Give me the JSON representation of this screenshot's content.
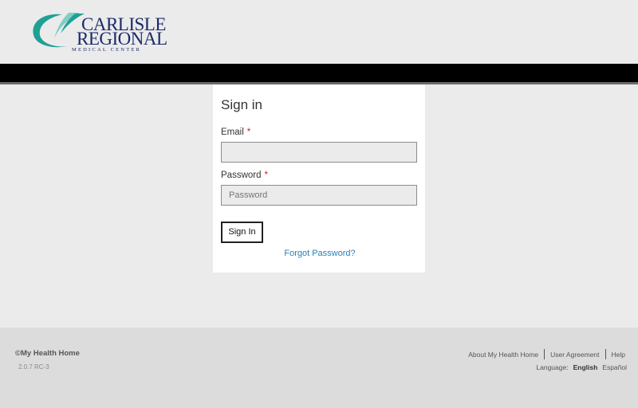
{
  "header": {
    "logo": {
      "line1": "CARLISLE",
      "line2": "REGIONAL",
      "line3": "MEDICAL CENTER",
      "colors": {
        "teal": "#1fa095",
        "navy": "#1b2a6b"
      }
    }
  },
  "signin": {
    "title": "Sign in",
    "email_label": "Email",
    "email_value": "",
    "password_label": "Password",
    "password_placeholder": "Password",
    "required_mark": "*",
    "submit_label": "Sign In",
    "forgot_link": "Forgot Password?"
  },
  "footer": {
    "copyright": "©My Health Home",
    "version": "2.0.7 RC-3",
    "links": [
      "About My Health Home",
      "User Agreement",
      "Help"
    ],
    "language_label": "Language:",
    "languages": [
      "English",
      "Español"
    ],
    "active_language": "English"
  },
  "colors": {
    "link": "#2a7fb5",
    "required": "#d21f1f",
    "bar": "#000000"
  }
}
